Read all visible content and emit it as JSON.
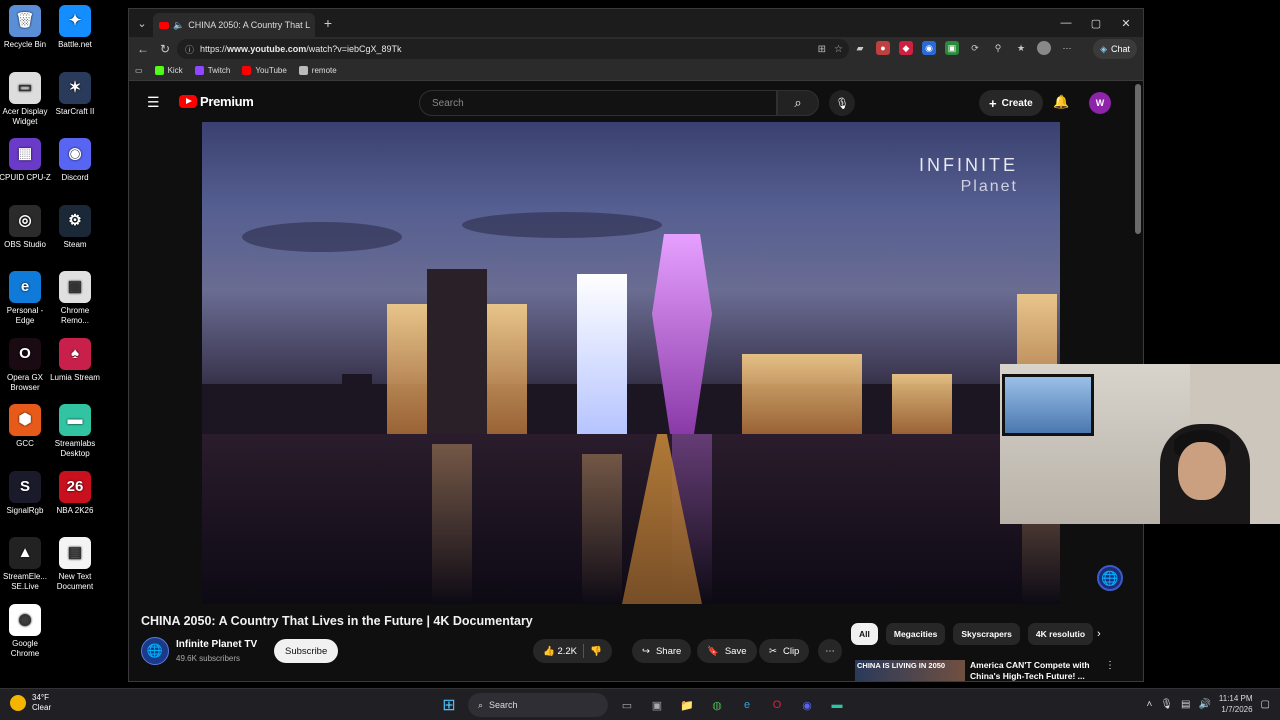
{
  "desktop": {
    "icons": [
      {
        "label": "Recycle Bin",
        "icon": "recycle-bin-icon",
        "color": "#5a8fd8",
        "glyph": "🗑"
      },
      {
        "label": "Battle.net",
        "icon": "battlenet-icon",
        "color": "#148eff",
        "glyph": "✦"
      },
      {
        "label": "Acer Display Widget",
        "icon": "acer-icon",
        "color": "#ddd",
        "glyph": "▭"
      },
      {
        "label": "StarCraft II",
        "icon": "starcraft-icon",
        "color": "#2a3a5a",
        "glyph": "✶"
      },
      {
        "label": "CPUID CPU-Z",
        "icon": "cpuz-icon",
        "color": "#6a3ac8",
        "glyph": "▦"
      },
      {
        "label": "Discord",
        "icon": "discord-icon",
        "color": "#5865f2",
        "glyph": "◉"
      },
      {
        "label": "OBS Studio",
        "icon": "obs-icon",
        "color": "#2b2b2b",
        "glyph": "◎"
      },
      {
        "label": "Steam",
        "icon": "steam-icon",
        "color": "#1b2838",
        "glyph": "⚙"
      },
      {
        "label": "Personal - Edge",
        "icon": "edge-icon",
        "color": "#0f7ad8",
        "glyph": "e"
      },
      {
        "label": "Chrome Remo...",
        "icon": "chrome-remote-icon",
        "color": "#e0e0e0",
        "glyph": "▣"
      },
      {
        "label": "Opera GX Browser",
        "icon": "operagx-icon",
        "color": "#1a0a12",
        "glyph": "O"
      },
      {
        "label": "Lumia Stream",
        "icon": "lumia-icon",
        "color": "#c8204a",
        "glyph": "♠"
      },
      {
        "label": "GCC",
        "icon": "gcc-icon",
        "color": "#e85a1a",
        "glyph": "⬢"
      },
      {
        "label": "Streamlabs Desktop",
        "icon": "streamlabs-icon",
        "color": "#31c3a2",
        "glyph": "▬"
      },
      {
        "label": "SignalRgb",
        "icon": "signalrgb-icon",
        "color": "#1a1a2a",
        "glyph": "S"
      },
      {
        "label": "NBA 2K26",
        "icon": "nba2k-icon",
        "color": "#c8101e",
        "glyph": "26"
      },
      {
        "label": "StreamEle... SE.Live",
        "icon": "streamelements-icon",
        "color": "#222",
        "glyph": "▲"
      },
      {
        "label": "New Text Document",
        "icon": "text-document-icon",
        "color": "#f4f4f4",
        "glyph": "▤"
      },
      {
        "label": "Google Chrome",
        "icon": "chrome-icon",
        "color": "#fff",
        "glyph": "◍"
      }
    ]
  },
  "browser": {
    "tab_title": "CHINA 2050: A Country That L",
    "url_prefix": "https://",
    "url_host": "www.youtube.com",
    "url_path": "/watch?v=iebCgX_89Tk",
    "chat_label": "Chat",
    "bookmarks": [
      {
        "label": "Kick",
        "color": "#53fc18"
      },
      {
        "label": "Twitch",
        "color": "#9146ff"
      },
      {
        "label": "YouTube",
        "color": "#ff0000"
      },
      {
        "label": "remote",
        "color": "#bbbbbb"
      }
    ]
  },
  "youtube": {
    "logo_text": "Premium",
    "search_placeholder": "Search",
    "create_label": "Create",
    "avatar_letter": "W",
    "video_brand": "INFINITE",
    "video_brand_sub": "Planet",
    "video_title": "CHINA 2050: A Country That Lives in the Future | 4K Documentary",
    "channel_name": "Infinite Planet TV",
    "channel_subs": "49.6K subscribers",
    "subscribe_label": "Subscribe",
    "likes": "2.2K",
    "share_label": "Share",
    "save_label": "Save",
    "clip_label": "Clip",
    "chips": [
      "All",
      "Megacities",
      "Skyscrapers",
      "4K resolutio"
    ],
    "rec_thumb_text": "CHINA IS LIVING IN 2050",
    "rec_title": "America CAN'T Compete with China's High-Tech Future! ..."
  },
  "taskbar": {
    "temperature": "34°F",
    "condition": "Clear",
    "search_label": "Search",
    "time": "11:14 PM",
    "date": "1/7/2026"
  },
  "colors": {
    "accent_red": "#ff0000",
    "avatar_purple": "#8e24aa",
    "taskbar_bg": "#1f1f24"
  }
}
